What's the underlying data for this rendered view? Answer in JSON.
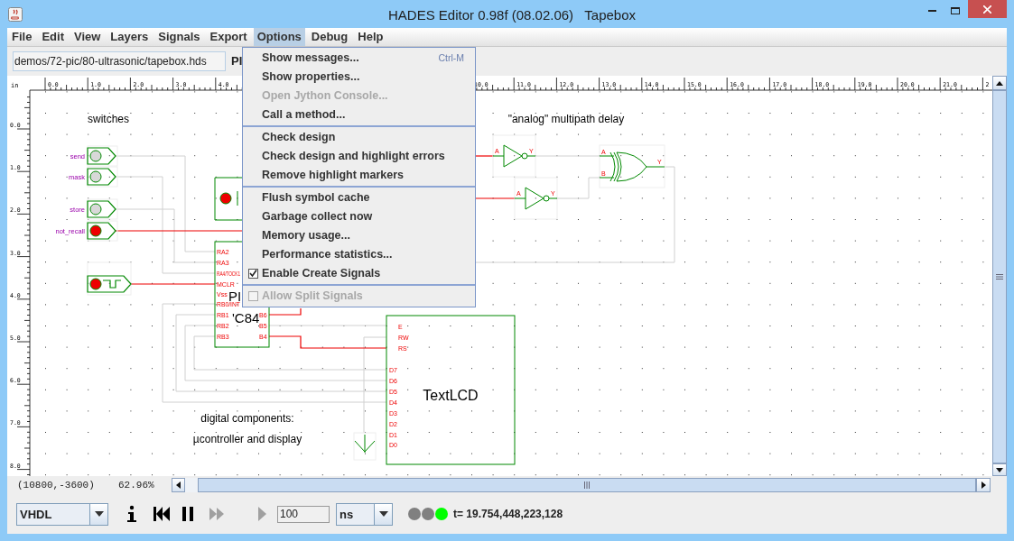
{
  "window": {
    "title": "HADES Editor 0.98f (08.02.06)   Tapebox"
  },
  "menu_bar": [
    {
      "label": "File",
      "selected": false
    },
    {
      "label": "Edit",
      "selected": false
    },
    {
      "label": "View",
      "selected": false
    },
    {
      "label": "Layers",
      "selected": false
    },
    {
      "label": "Signals",
      "selected": false
    },
    {
      "label": "Export",
      "selected": false
    },
    {
      "label": "Options",
      "selected": true
    },
    {
      "label": "Debug",
      "selected": false
    },
    {
      "label": "Help",
      "selected": false
    }
  ],
  "options_menu": {
    "groups": [
      [
        {
          "kind": "item",
          "label": "Show messages...",
          "shortcut": "Ctrl-M",
          "disabled": false
        },
        {
          "kind": "item",
          "label": "Show properties...",
          "disabled": false
        },
        {
          "kind": "item",
          "label": "Open Jython Console...",
          "disabled": true
        },
        {
          "kind": "item",
          "label": "Call a method...",
          "disabled": false
        }
      ],
      [
        {
          "kind": "item",
          "label": "Check design",
          "disabled": false
        },
        {
          "kind": "item",
          "label": "Check design and highlight errors",
          "disabled": false
        },
        {
          "kind": "item",
          "label": "Remove highlight markers",
          "disabled": false
        }
      ],
      [
        {
          "kind": "item",
          "label": "Flush symbol cache",
          "disabled": false
        },
        {
          "kind": "item",
          "label": "Garbage collect now",
          "disabled": false
        },
        {
          "kind": "item",
          "label": "Memory usage...",
          "disabled": false
        },
        {
          "kind": "item",
          "label": "Performance statistics...",
          "disabled": false
        },
        {
          "kind": "check",
          "label": "Enable Create Signals",
          "checked": true,
          "disabled": false
        }
      ],
      [
        {
          "kind": "check",
          "label": "Allow Split Signals",
          "checked": false,
          "disabled": true
        }
      ]
    ]
  },
  "toolbar": {
    "path": "demos/72-pic/80-ultrasonic/tapebox.hds",
    "label": "PI"
  },
  "rulers": {
    "unit": "in",
    "x_labels": [
      "0.0",
      "1.0",
      "2.0",
      "3.0",
      "4.0",
      "10.0",
      "11.0",
      "12.0",
      "13.0",
      "14.0",
      "15.0",
      "16.0",
      "17.0",
      "18.0",
      "19.0",
      "20.0",
      "21.0",
      "2"
    ],
    "y_labels": [
      "0.0",
      "1.0",
      "2.0",
      "3.0",
      "4.0",
      "5.0",
      "6.0",
      "7.0",
      "8.0"
    ]
  },
  "schematic": {
    "switches_title": "switches",
    "switches": [
      {
        "label": "send",
        "on": false
      },
      {
        "label": "mask",
        "on": false
      },
      {
        "label": "store",
        "on": false
      },
      {
        "label": "not_recall",
        "on": true
      }
    ],
    "clock": {
      "on": true
    },
    "pulse_switch": {
      "on": true
    },
    "pic": {
      "name_lines": [
        "PI",
        "'C84"
      ],
      "left_pins": [
        "RA2",
        "RA3",
        "RA4/TOCK1",
        "MCLR",
        "Vss",
        "RB0/INT",
        "RB1",
        "RB2",
        "RB3"
      ],
      "right_pins": [
        "B6",
        "B5",
        "B4"
      ]
    },
    "lcd": {
      "name": "TextLCD",
      "pins": [
        "E",
        "RW",
        "RS",
        "D7",
        "D6",
        "D5",
        "D4",
        "D3",
        "D2",
        "D1",
        "D0"
      ]
    },
    "digital_note": [
      "digital components:",
      "µcontroller and display"
    ],
    "analog_note": "\"analog\" multipath delay",
    "gates": [
      {
        "kind": "inverter",
        "pins": [
          "A",
          "Y"
        ]
      },
      {
        "kind": "inverter",
        "pins": [
          "A",
          "Y"
        ]
      },
      {
        "kind": "xor",
        "pins": [
          "A",
          "B",
          "Y"
        ]
      }
    ]
  },
  "status": {
    "coordinates": "(10800,-3600)",
    "zoom": "62.96%"
  },
  "simulation": {
    "language": "VHDL",
    "controls": [
      {
        "kind": "info",
        "disabled": false
      },
      {
        "kind": "rewind",
        "disabled": false
      },
      {
        "kind": "pause",
        "disabled": false
      },
      {
        "kind": "fast_forward",
        "disabled": true
      },
      {
        "kind": "step",
        "disabled": true
      }
    ],
    "step_size": "100",
    "unit": "ns",
    "leds": [
      {
        "color": "#808080"
      },
      {
        "color": "#808080"
      },
      {
        "color": "#00ff00"
      }
    ],
    "time": "t= 19.754,448,223,128"
  }
}
